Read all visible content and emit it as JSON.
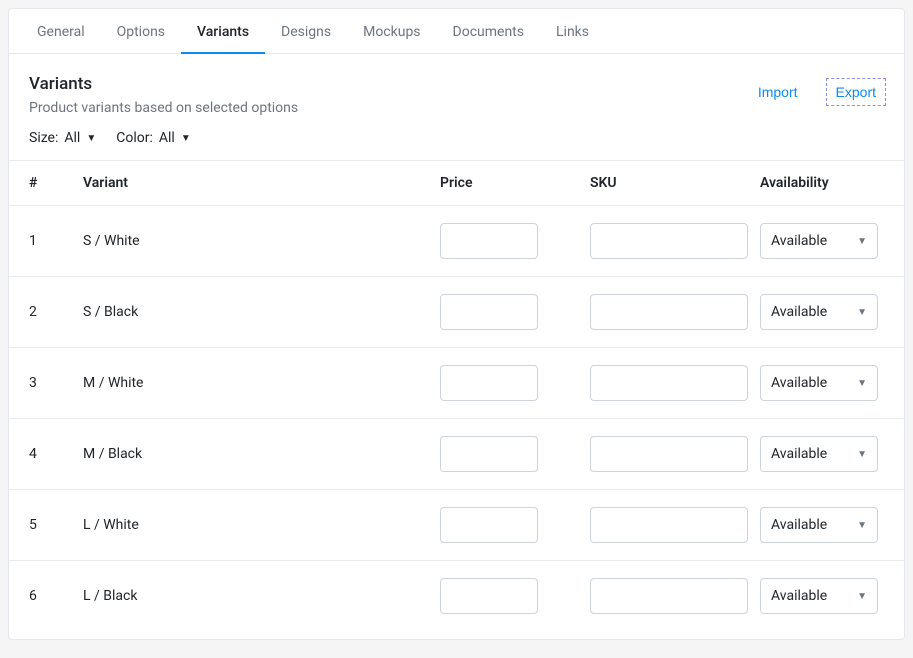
{
  "tabs": [
    {
      "label": "General"
    },
    {
      "label": "Options"
    },
    {
      "label": "Variants",
      "active": true
    },
    {
      "label": "Designs"
    },
    {
      "label": "Mockups"
    },
    {
      "label": "Documents"
    },
    {
      "label": "Links"
    }
  ],
  "panel": {
    "title": "Variants",
    "subtitle": "Product variants based on selected options",
    "import_label": "Import",
    "export_label": "Export"
  },
  "filters": {
    "size_label": "Size:",
    "size_value": "All",
    "color_label": "Color:",
    "color_value": "All"
  },
  "columns": {
    "num": "#",
    "variant": "Variant",
    "price": "Price",
    "sku": "SKU",
    "availability": "Availability"
  },
  "rows": [
    {
      "num": "1",
      "variant": "S / White",
      "price": "",
      "sku": "",
      "availability": "Available"
    },
    {
      "num": "2",
      "variant": "S / Black",
      "price": "",
      "sku": "",
      "availability": "Available"
    },
    {
      "num": "3",
      "variant": "M / White",
      "price": "",
      "sku": "",
      "availability": "Available"
    },
    {
      "num": "4",
      "variant": "M / Black",
      "price": "",
      "sku": "",
      "availability": "Available"
    },
    {
      "num": "5",
      "variant": "L / White",
      "price": "",
      "sku": "",
      "availability": "Available"
    },
    {
      "num": "6",
      "variant": "L / Black",
      "price": "",
      "sku": "",
      "availability": "Available"
    }
  ]
}
